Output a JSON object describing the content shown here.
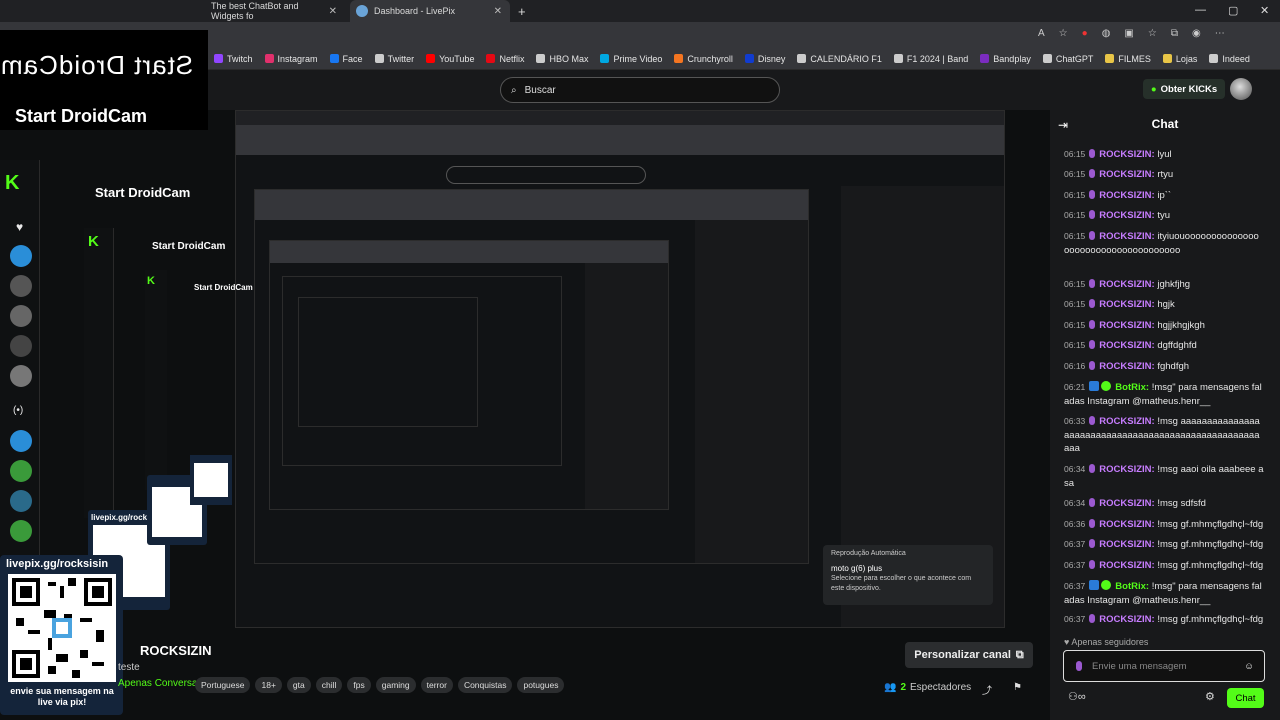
{
  "browser": {
    "tabs": [
      {
        "title": "The best ChatBot and Widgets fo"
      },
      {
        "title": "Dashboard - LivePix"
      }
    ],
    "new_tab": "+",
    "window_controls": [
      "—",
      "▢",
      "✕"
    ],
    "bookmarks": [
      {
        "label": "Twitch",
        "color": "#9146ff"
      },
      {
        "label": "Instagram",
        "color": "#e1306c"
      },
      {
        "label": "Face",
        "color": "#1877f2"
      },
      {
        "label": "Twitter",
        "color": "#cccccc"
      },
      {
        "label": "YouTube",
        "color": "#ff0000"
      },
      {
        "label": "Netflix",
        "color": "#e50914"
      },
      {
        "label": "HBO Max",
        "color": "#cccccc"
      },
      {
        "label": "Prime Video",
        "color": "#00a8e1"
      },
      {
        "label": "Crunchyroll",
        "color": "#f47521"
      },
      {
        "label": "Disney",
        "color": "#113ccf"
      },
      {
        "label": "CALENDÁRIO F1",
        "color": "#cccccc"
      },
      {
        "label": "F1 2024 | Band",
        "color": "#cccccc"
      },
      {
        "label": "Bandplay",
        "color": "#7b2cbf"
      },
      {
        "label": "ChatGPT",
        "color": "#cccccc"
      },
      {
        "label": "FILMES",
        "color": "#e8c547"
      },
      {
        "label": "Lojas",
        "color": "#e8c547"
      },
      {
        "label": "Indeed",
        "color": "#cccccc"
      }
    ]
  },
  "header": {
    "search_placeholder": "Buscar",
    "kicks_button": "Obter KICKs"
  },
  "overlay": {
    "droidcam_mirror": "Start DroidCam",
    "droidcam": "Start DroidCam",
    "qr_url": "livepix.gg/rocksisin",
    "qr_text": "envie sua mensagem na live via pix!"
  },
  "notification": {
    "title": "Reprodução Automática",
    "device": "moto g(6) plus",
    "body": "Selecione para escolher o que acontece com este dispositivo."
  },
  "stream": {
    "name": "ROCKSIZIN",
    "title": "teste",
    "category": "Apenas Conversa",
    "tags": [
      "Portuguese",
      "18+",
      "gta",
      "chill",
      "fps",
      "gaming",
      "terror",
      "Conquistas",
      "potugues"
    ],
    "personalize": "Personalizar canal",
    "viewers_count": "2",
    "viewers_label": "Espectadores"
  },
  "chat": {
    "title": "Chat",
    "followers_only": "Apenas seguidores",
    "input_placeholder": "Envie uma mensagem",
    "send": "Chat",
    "messages": [
      {
        "time": "06:15",
        "user": "ROCKSIZIN:",
        "text": "lyul",
        "bot": false
      },
      {
        "time": "06:15",
        "user": "ROCKSIZIN:",
        "text": "rtyu",
        "bot": false
      },
      {
        "time": "06:15",
        "user": "ROCKSIZIN:",
        "text": "ip``",
        "bot": false
      },
      {
        "time": "06:15",
        "user": "ROCKSIZIN:",
        "text": "tyu",
        "bot": false
      },
      {
        "time": "06:15",
        "user": "ROCKSIZIN:",
        "text": "ityiuouoooooooooooooooooooooooooooooooooooo",
        "bot": false
      },
      {
        "time": "06:15",
        "user": "ROCKSIZIN:",
        "text": "jghkfjhg",
        "bot": false
      },
      {
        "time": "06:15",
        "user": "ROCKSIZIN:",
        "text": "hgjk",
        "bot": false
      },
      {
        "time": "06:15",
        "user": "ROCKSIZIN:",
        "text": "hgjjkhgjkgh",
        "bot": false
      },
      {
        "time": "06:15",
        "user": "ROCKSIZIN:",
        "text": "dgffdghfd",
        "bot": false
      },
      {
        "time": "06:16",
        "user": "ROCKSIZIN:",
        "text": "fghdfgh",
        "bot": false
      },
      {
        "time": "06:21",
        "user": "BotRix:",
        "text": "!msg\" para mensagens faladas Instagram @matheus.henr__",
        "bot": true
      },
      {
        "time": "06:33",
        "user": "ROCKSIZIN:",
        "text": "!msg aaaaaaaaaaaaaaaaaaaaaaaaaaaaaaaaaaaaaaaaaaaaaaaaaaaaaaa",
        "bot": false
      },
      {
        "time": "06:34",
        "user": "ROCKSIZIN:",
        "text": "!msg aaoi oila aaabeee asa",
        "bot": false
      },
      {
        "time": "06:34",
        "user": "ROCKSIZIN:",
        "text": "!msg sdfsfd",
        "bot": false
      },
      {
        "time": "06:36",
        "user": "ROCKSIZIN:",
        "text": "!msg gf.mhmçflgdhçl~fdg",
        "bot": false
      },
      {
        "time": "06:37",
        "user": "ROCKSIZIN:",
        "text": "!msg gf.mhmçflgdhçl~fdg",
        "bot": false
      },
      {
        "time": "06:37",
        "user": "ROCKSIZIN:",
        "text": "!msg gf.mhmçflgdhçl~fdg",
        "bot": false
      },
      {
        "time": "06:37",
        "user": "BotRix:",
        "text": "!msg\" para mensagens faladas Instagram @matheus.henr__",
        "bot": true
      },
      {
        "time": "06:37",
        "user": "ROCKSIZIN:",
        "text": "!msg gf.mhmçflgdhçl~fdg",
        "bot": false
      }
    ]
  },
  "colors": {
    "kick_green": "#53fc18",
    "username_purple": "#c77dff",
    "panel": "#18191b"
  },
  "icons": [
    "search-icon",
    "chat-collapse-icon",
    "gear-icon",
    "share-icon",
    "follow-icon",
    "users-icon",
    "external-link-icon",
    "emoji-icon",
    "mic-icon",
    "verified-icon"
  ]
}
